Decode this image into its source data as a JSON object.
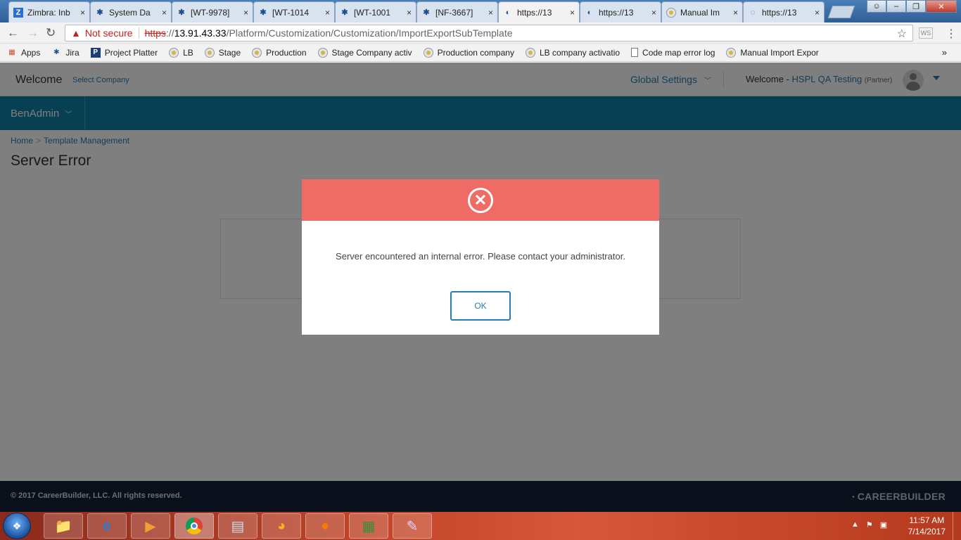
{
  "browser": {
    "tabs": [
      {
        "title": "Zimbra: Inb",
        "icon": "zimbra-icon",
        "active": false
      },
      {
        "title": "System Da",
        "icon": "jira-icon",
        "active": false
      },
      {
        "title": "[WT-9978]",
        "icon": "jira-icon",
        "active": false
      },
      {
        "title": "[WT-1014",
        "icon": "jira-icon",
        "active": false
      },
      {
        "title": "[WT-1001",
        "icon": "jira-icon",
        "active": false
      },
      {
        "title": "[NF-3667]",
        "icon": "jira-icon",
        "active": false
      },
      {
        "title": "https://13",
        "icon": "page-icon",
        "active": true
      },
      {
        "title": "https://13",
        "icon": "page-icon",
        "active": false
      },
      {
        "title": "Manual Im",
        "icon": "site-icon",
        "active": false
      },
      {
        "title": "https://13",
        "icon": "loading-icon",
        "active": false
      }
    ],
    "tab_close_glyph": "×",
    "security_label": "Not secure",
    "url": {
      "scheme": "https",
      "rest_scheme": "://",
      "host": "13.91.43.33",
      "path": "/Platform/Customization/Customization/ImportExportSubTemplate"
    },
    "extension_label": "WS",
    "bookmarks": [
      {
        "label": "Apps",
        "icon": "apps-grid-icon"
      },
      {
        "label": "Jira",
        "icon": "jira-icon"
      },
      {
        "label": "Project Platter",
        "icon": "p-icon"
      },
      {
        "label": "LB",
        "icon": "site-icon"
      },
      {
        "label": "Stage",
        "icon": "site-icon"
      },
      {
        "label": "Production",
        "icon": "site-icon"
      },
      {
        "label": "Stage Company activ",
        "icon": "site-icon"
      },
      {
        "label": "Production company",
        "icon": "site-icon"
      },
      {
        "label": "LB company activatio",
        "icon": "site-icon"
      },
      {
        "label": "Code map error log",
        "icon": "page-icon"
      },
      {
        "label": "Manual Import Expor",
        "icon": "site-icon"
      }
    ],
    "bookmarks_more": "»"
  },
  "app": {
    "welcome": "Welcome",
    "select_company": "Select Company",
    "global_settings": "Global Settings",
    "welcome_prefix": "Welcome -",
    "user_name": "HSPL QA Testing",
    "user_role": "(Partner)",
    "nav_menu": "BenAdmin",
    "breadcrumb": {
      "home": "Home",
      "sep": ">",
      "current": "Template Management"
    },
    "page_title": "Server Error",
    "footer_copyright": "© 2017 CareerBuilder, LLC. All rights reserved.",
    "footer_brand": "CAREERBUILDER"
  },
  "modal": {
    "icon": "error-circle-icon",
    "message": "Server encountered an internal error. Please contact your administrator.",
    "ok_label": "OK",
    "header_color": "#ef6b66"
  },
  "taskbar": {
    "apps": [
      "file-explorer-icon",
      "internet-explorer-icon",
      "media-player-icon",
      "chrome-icon",
      "notepad-icon",
      "app-icon",
      "firefox-icon",
      "spreadsheet-icon",
      "paint-icon"
    ],
    "time": "11:57 AM",
    "date": "7/14/2017"
  },
  "colors": {
    "accent": "#0f7ea6",
    "link": "#2a7ab0",
    "footer": "#122038"
  }
}
